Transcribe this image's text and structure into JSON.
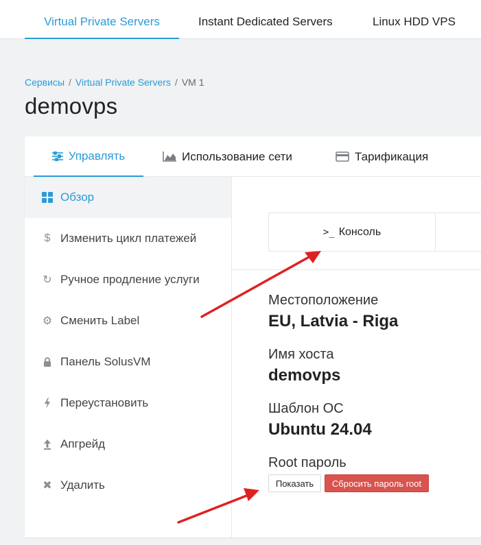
{
  "top_nav": {
    "tabs": [
      {
        "label": "Virtual Private Servers",
        "active": true
      },
      {
        "label": "Instant Dedicated Servers",
        "active": false
      },
      {
        "label": "Linux HDD VPS",
        "active": false
      }
    ]
  },
  "breadcrumb": {
    "items": [
      "Сервисы",
      "Virtual Private Servers",
      "VM 1"
    ]
  },
  "page_title": "demovps",
  "panel_tabs": [
    {
      "label": "Управлять",
      "icon": "sliders-icon",
      "active": true
    },
    {
      "label": "Использование сети",
      "icon": "area-chart-icon",
      "active": false
    },
    {
      "label": "Тарификация",
      "icon": "credit-card-icon",
      "active": false
    }
  ],
  "sidebar": {
    "items": [
      {
        "label": "Обзор",
        "icon": "grid-icon",
        "active": true
      },
      {
        "label": "Изменить цикл платежей",
        "icon": "dollar-icon",
        "active": false
      },
      {
        "label": "Ручное продление услуги",
        "icon": "refresh-icon",
        "active": false
      },
      {
        "label": "Сменить Label",
        "icon": "gear-icon",
        "active": false
      },
      {
        "label": "Панель SolusVM",
        "icon": "lock-icon",
        "active": false
      },
      {
        "label": "Переустановить",
        "icon": "bolt-icon",
        "active": false
      },
      {
        "label": "Апгрейд",
        "icon": "upload-icon",
        "active": false
      },
      {
        "label": "Удалить",
        "icon": "close-icon",
        "active": false
      }
    ]
  },
  "main": {
    "console_prompt": ">_",
    "console_label": "Консоль",
    "location_label": "Местоположение",
    "location_value": "EU, Latvia - Riga",
    "hostname_label": "Имя хоста",
    "hostname_value": "demovps",
    "os_label": "Шаблон ОС",
    "os_value": "Ubuntu 24.04",
    "root_label": "Root пароль",
    "show_button": "Показать",
    "reset_button": "Сбросить пароль root"
  },
  "colors": {
    "accent": "#2a9bd6",
    "danger": "#d9534f",
    "arrow": "#e02020"
  }
}
